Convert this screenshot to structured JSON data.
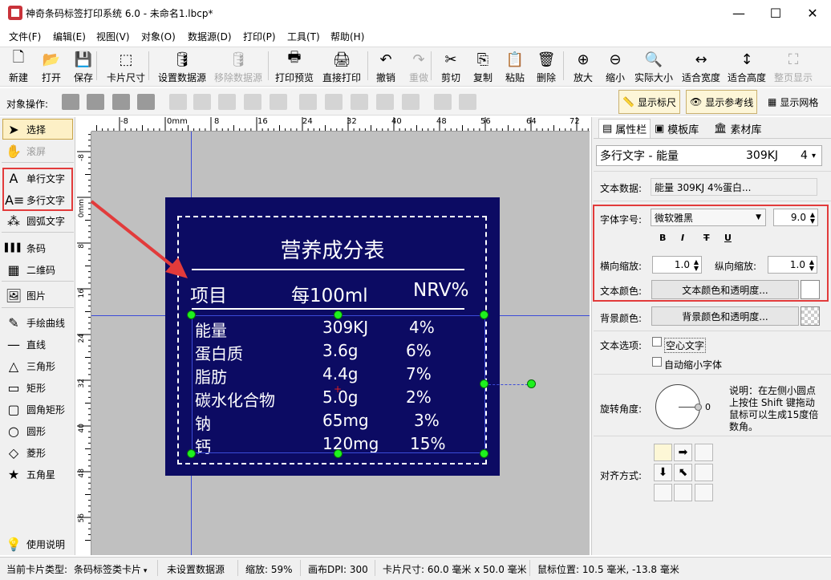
{
  "title": "神奇条码标签打印系统 6.0 - 未命名1.lbcp*",
  "window_controls": {
    "minimize": "—",
    "maximize": "☐",
    "close": "✕"
  },
  "menu": [
    "文件(F)",
    "编辑(E)",
    "视图(V)",
    "对象(O)",
    "数据源(D)",
    "打印(P)",
    "工具(T)",
    "帮助(H)"
  ],
  "toolbar": [
    {
      "label": "新建",
      "icon": "new-file-icon",
      "glyph": "🗋",
      "enabled": true
    },
    {
      "label": "打开",
      "icon": "open-icon",
      "glyph": "📂",
      "enabled": true
    },
    {
      "label": "保存",
      "icon": "save-icon",
      "glyph": "💾",
      "enabled": true
    },
    {
      "label": "卡片尺寸",
      "icon": "card-size-icon",
      "glyph": "⬚",
      "enabled": true
    },
    {
      "label": "设置数据源",
      "icon": "database-settings-icon",
      "glyph": "🛢",
      "enabled": true
    },
    {
      "label": "移除数据源",
      "icon": "database-remove-icon",
      "glyph": "🛢",
      "enabled": false
    },
    {
      "label": "打印预览",
      "icon": "print-preview-icon",
      "glyph": "🖶",
      "enabled": true
    },
    {
      "label": "直接打印",
      "icon": "print-icon",
      "glyph": "🖨",
      "enabled": true
    },
    {
      "label": "撤销",
      "icon": "undo-icon",
      "glyph": "↶",
      "enabled": true
    },
    {
      "label": "重做",
      "icon": "redo-icon",
      "glyph": "↷",
      "enabled": false
    },
    {
      "label": "剪切",
      "icon": "cut-icon",
      "glyph": "✂",
      "enabled": true
    },
    {
      "label": "复制",
      "icon": "copy-icon",
      "glyph": "⎘",
      "enabled": true
    },
    {
      "label": "粘贴",
      "icon": "paste-icon",
      "glyph": "📋",
      "enabled": true
    },
    {
      "label": "删除",
      "icon": "delete-icon",
      "glyph": "🗑",
      "enabled": true
    },
    {
      "label": "放大",
      "icon": "zoom-in-icon",
      "glyph": "⊕",
      "enabled": true
    },
    {
      "label": "缩小",
      "icon": "zoom-out-icon",
      "glyph": "⊖",
      "enabled": true
    },
    {
      "label": "实际大小",
      "icon": "actual-size-icon",
      "glyph": "🔍",
      "enabled": true
    },
    {
      "label": "适合宽度",
      "icon": "fit-width-icon",
      "glyph": "↔",
      "enabled": true
    },
    {
      "label": "适合高度",
      "icon": "fit-height-icon",
      "glyph": "↕",
      "enabled": true
    },
    {
      "label": "整页显示",
      "icon": "full-page-icon",
      "glyph": "⛶",
      "enabled": false
    }
  ],
  "object_ops_label": "对象操作:",
  "toggles": {
    "ruler": "显示标尺",
    "guides": "显示参考线",
    "grid": "显示网格"
  },
  "tools": [
    {
      "label": "选择",
      "icon": "select-arrow-icon",
      "glyph": "➤"
    },
    {
      "label": "滚屏",
      "icon": "hand-scroll-icon",
      "glyph": "✋"
    },
    {
      "label": "单行文字",
      "icon": "single-line-text-icon",
      "glyph": "A"
    },
    {
      "label": "多行文字",
      "icon": "multi-line-text-icon",
      "glyph": "A≡"
    },
    {
      "label": "圆弧文字",
      "icon": "arc-text-icon",
      "glyph": "⁂"
    },
    {
      "label": "条码",
      "icon": "barcode-icon",
      "glyph": "▌▌▌"
    },
    {
      "label": "二维码",
      "icon": "qrcode-icon",
      "glyph": "▦"
    },
    {
      "label": "图片",
      "icon": "image-icon",
      "glyph": "🖼"
    },
    {
      "label": "手绘曲线",
      "icon": "freehand-icon",
      "glyph": "✎"
    },
    {
      "label": "直线",
      "icon": "line-icon",
      "glyph": "—"
    },
    {
      "label": "三角形",
      "icon": "triangle-icon",
      "glyph": "△"
    },
    {
      "label": "矩形",
      "icon": "rectangle-icon",
      "glyph": "▭"
    },
    {
      "label": "圆角矩形",
      "icon": "rounded-rect-icon",
      "glyph": "▢"
    },
    {
      "label": "圆形",
      "icon": "circle-icon",
      "glyph": "○"
    },
    {
      "label": "菱形",
      "icon": "diamond-icon",
      "glyph": "◇"
    },
    {
      "label": "五角星",
      "icon": "star-icon",
      "glyph": "★"
    }
  ],
  "help_label": "使用说明",
  "ruler_top_labels": [
    "-8",
    "0mm",
    "8",
    "16",
    "24",
    "32",
    "40",
    "48",
    "56",
    "64",
    "72"
  ],
  "ruler_left_labels": [
    "-8",
    "0mm",
    "8",
    "16",
    "24",
    "32",
    "40",
    "48",
    "56"
  ],
  "card": {
    "title": "营养成分表",
    "header": [
      "项目",
      "每100ml",
      "NRV%"
    ],
    "rows": [
      [
        "能量",
        "309KJ",
        "4%"
      ],
      [
        "蛋白质",
        "3.6g",
        "6%"
      ],
      [
        "脂肪",
        "4.4g",
        "7%"
      ],
      [
        "碳水化合物",
        "5.0g",
        "2%"
      ],
      [
        "钠",
        "65mg",
        "3%"
      ],
      [
        "钙",
        "120mg",
        "15%"
      ]
    ],
    "bg_color": "#0c0b63"
  },
  "panel": {
    "tabs": [
      "属性栏",
      "模板库",
      "素材库"
    ],
    "object_select": {
      "name": "多行文字 - 能量",
      "value": "309KJ",
      "suffix": "4"
    },
    "text_data_label": "文本数据:",
    "text_data_value": "能量            309KJ        4%蛋白...",
    "font_label": "字体字号:",
    "font_name": "微软雅黑",
    "font_size": "9.0",
    "style_buttons": [
      "B",
      "I",
      "T",
      "U"
    ],
    "hscale_label": "横向缩放:",
    "hscale": "1.0",
    "vscale_label": "纵向缩放:",
    "vscale": "1.0",
    "text_color_label": "文本颜色:",
    "text_color_btn": "文本颜色和透明度...",
    "bg_color_label": "背景颜色:",
    "bg_color_btn": "背景颜色和透明度...",
    "text_options_label": "文本选项:",
    "hollow_text": "空心文字",
    "auto_shrink": "自动缩小字体",
    "rotation_label": "旋转角度:",
    "rotation_value": "0",
    "rotation_note": "说明：在左侧小圆点上按住 Shift 键拖动鼠标可以生成15度倍数角。",
    "align_label": "对齐方式:"
  },
  "status": {
    "card_type_label": "当前卡片类型:",
    "card_type": "条码标签类卡片",
    "datasource": "未设置数据源",
    "zoom": "缩放: 59%",
    "dpi": "画布DPI: 300",
    "card_size": "卡片尺寸: 60.0 毫米 x 50.0 毫米",
    "mouse_pos": "鼠标位置: 10.5 毫米, -13.8 毫米"
  }
}
